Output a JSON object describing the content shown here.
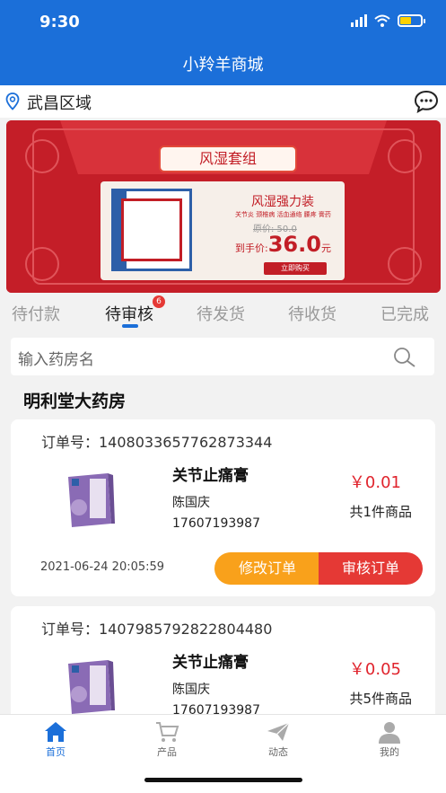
{
  "status_bar": {
    "time": "9:30"
  },
  "header": {
    "title": "小羚羊商城"
  },
  "location": {
    "region": "武昌区域"
  },
  "banner": {
    "title": "风湿套组",
    "headline": "风湿强力装",
    "tagline": "关节炎 颈椎病 活血通络 腰疼 膏药",
    "original_price": "原价: 50.0",
    "deal_label": "到手价:",
    "deal_price": "36.0",
    "deal_unit": "元",
    "buy_button": "立即购买"
  },
  "tabs": [
    {
      "label": "待付款",
      "active": false
    },
    {
      "label": "待审核",
      "active": true,
      "badge": "6"
    },
    {
      "label": "待发货",
      "active": false
    },
    {
      "label": "待收货",
      "active": false
    },
    {
      "label": "已完成",
      "active": false
    }
  ],
  "search": {
    "placeholder": "输入药房名"
  },
  "pharmacy_name": "明利堂大药房",
  "orders": [
    {
      "order_no": "订单号：1408033657762873344",
      "product": "关节止痛膏",
      "customer": "陈国庆",
      "phone": "17607193987",
      "price": "￥0.01",
      "quantity": "共1件商品",
      "date": "2021-06-24 20:05:59",
      "edit_label": "修改订单",
      "review_label": "审核订单"
    },
    {
      "order_no": "订单号：1407985792822804480",
      "product": "关节止痛膏",
      "customer": "陈国庆",
      "phone": "17607193987",
      "price": "￥0.05",
      "quantity": "共5件商品"
    }
  ],
  "bottom_nav": [
    {
      "label": "首页",
      "icon": "home-icon",
      "active": true
    },
    {
      "label": "产品",
      "icon": "cart-icon",
      "active": false
    },
    {
      "label": "动态",
      "icon": "paper-plane-icon",
      "active": false
    },
    {
      "label": "我的",
      "icon": "user-icon",
      "active": false
    }
  ],
  "colors": {
    "brand": "#1b6fd9",
    "price": "#e0242d",
    "edit": "#f9a11b",
    "review": "#e53935"
  }
}
